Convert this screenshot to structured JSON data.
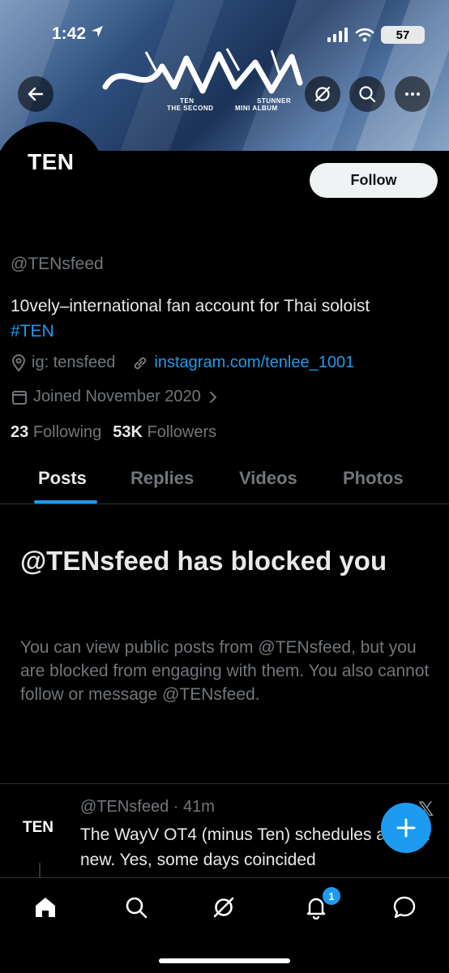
{
  "status_bar": {
    "time": "1:42",
    "battery": "57"
  },
  "banner": {
    "artist": "TEN",
    "edition": "THE SECOND",
    "album_name": "STUNNER",
    "album_type": "MINI ALBUM"
  },
  "profile": {
    "avatar_text": "TEN",
    "follow_label": "Follow",
    "handle": "@TENsfeed",
    "bio_text": "10vely–international fan account for Thai soloist ",
    "bio_hashtag": "#TEN",
    "instagram": "ig: tensfeed",
    "website": "instagram.com/tenlee_1001",
    "joined": "Joined November 2020",
    "following_count": "23",
    "following_label": "Following",
    "followers_count": "53K",
    "followers_label": "Followers"
  },
  "tabs": [
    {
      "label": "Posts",
      "active": true
    },
    {
      "label": "Replies",
      "active": false
    },
    {
      "label": "Videos",
      "active": false
    },
    {
      "label": "Photos",
      "active": false
    }
  ],
  "blocked": {
    "title": "@TENsfeed has blocked you",
    "body": "You can view public posts from @TENsfeed, but you are blocked from engaging with them. You also cannot follow or message @TENsfeed."
  },
  "post": {
    "avatar_text": "TEN",
    "handle": "@TENsfeed",
    "time": "41m",
    "text": "The WayV OT4 (minus Ten) schedules are not new. Yes, some days coincided"
  },
  "bottom_nav": {
    "notification_count": "1"
  },
  "colors": {
    "accent": "#1d9bf0",
    "background": "#000000",
    "muted": "#71767b"
  }
}
